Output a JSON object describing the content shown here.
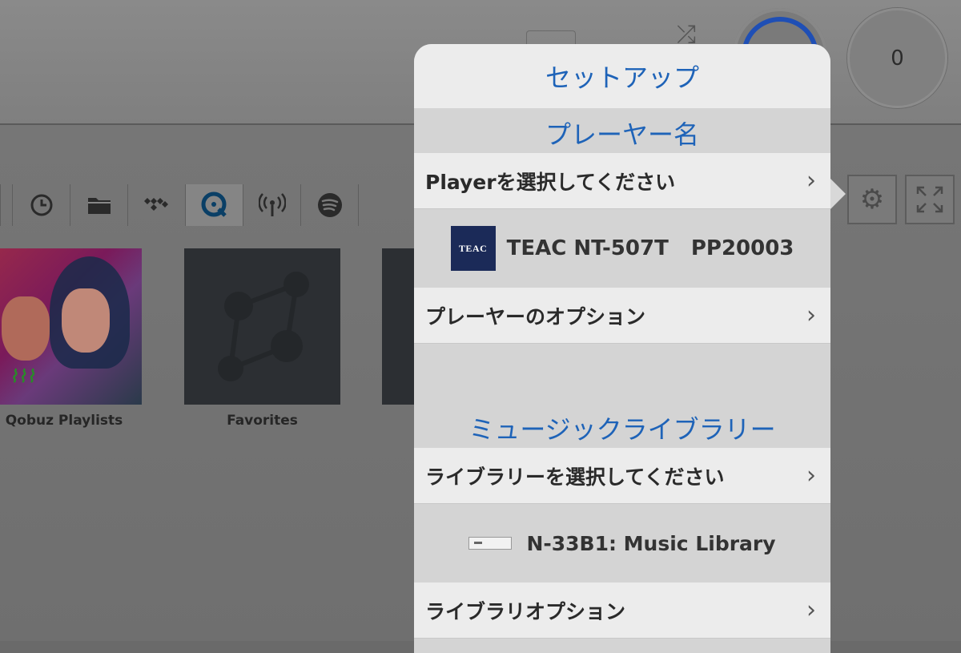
{
  "header": {
    "counter_value": "0"
  },
  "tabs": [
    {
      "name": "recent-icon",
      "glyph": "◷"
    },
    {
      "name": "folder-icon",
      "glyph": "▭"
    },
    {
      "name": "tidal-icon",
      "glyph": "⁘"
    },
    {
      "name": "qobuz-icon",
      "glyph": "◉"
    },
    {
      "name": "radio-icon",
      "glyph": "((•))"
    },
    {
      "name": "spotify-icon",
      "glyph": "≋"
    }
  ],
  "tiles": {
    "qobuz_label": "Qobuz Playlists",
    "favorites_label": "Favorites"
  },
  "popover": {
    "title": "セットアップ",
    "player_section": "プレーヤー名",
    "player_select": "Playerを選択してください",
    "player_device_brand": "TEAC",
    "player_device_name": "TEAC NT-507T",
    "player_device_id": "PP20003",
    "player_options": "プレーヤーのオプション",
    "library_section": "ミュージックライブラリー",
    "library_select": "ライブラリーを選択してください",
    "library_device": "N-33B1: Music Library",
    "library_options": "ライブラリオプション",
    "chevron": "›"
  },
  "colors": {
    "accent_blue": "#1e63b8",
    "teac_navy": "#1b2a58"
  }
}
